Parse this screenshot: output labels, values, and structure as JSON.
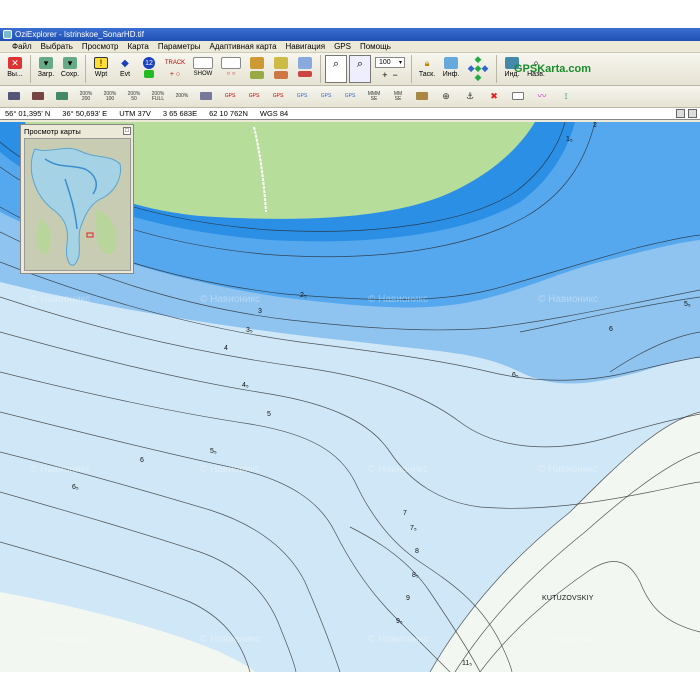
{
  "window": {
    "title": "OziExplorer - Istrinskoe_SonarHD.tif"
  },
  "menu": [
    "Файл",
    "Выбрать",
    "Просмотр",
    "Карта",
    "Параметры",
    "Адаптивная карта",
    "Навигация",
    "GPS",
    "Помощь"
  ],
  "toolbar": {
    "exit_label": "Вы...",
    "load_label": "Загр.",
    "save_label": "Сохр.",
    "wpt_label": "Wpt",
    "evt_label": "Evt",
    "wpt_count": "12",
    "track_label": "TRACK",
    "show_label": "SHOW",
    "zoom_value": "100",
    "task_label": "Таск.",
    "info_label": "Инф.",
    "ind_label": "Инд.",
    "nav_label": "Назв.",
    "brand": "GPSKarta.com"
  },
  "toolbar2": {
    "zoom_buttons": [
      "200%\n200",
      "200%\n100",
      "200%\n50",
      "200%\nFULL",
      "200%\n"
    ],
    "gps_buttons": [
      "GPS",
      "GPS",
      "GPS",
      "GPS",
      "GPS",
      "GPS"
    ],
    "mm_labels": [
      "MMM\nSE",
      "MM\nSE"
    ]
  },
  "coords": {
    "lat": "56° 01,395' N",
    "lon": "36° 50,693' E",
    "utm": "UTM  37V",
    "easting": "3 65 683E",
    "northing": "62 10 762N",
    "datum": "WGS 84"
  },
  "overview": {
    "title": "Просмотр карты"
  },
  "map": {
    "colors": {
      "land": "#b7dd9b",
      "deep": "#2c8fe6",
      "mid": "#56a8ee",
      "light": "#8fc3f0",
      "pale": "#cfe7f6",
      "shore": "#f2f7f2"
    },
    "depth_labels": [
      "2",
      "1₅",
      "2₅",
      "3",
      "3₅",
      "4",
      "4₅",
      "5",
      "5₅",
      "6",
      "6₅",
      "7",
      "7₅",
      "8",
      "8₅",
      "9",
      "9₅",
      "5₅",
      "6",
      "6₅",
      "11₅"
    ],
    "place": "KUTUZOVSKIY",
    "watermark": "© Навионикс"
  }
}
